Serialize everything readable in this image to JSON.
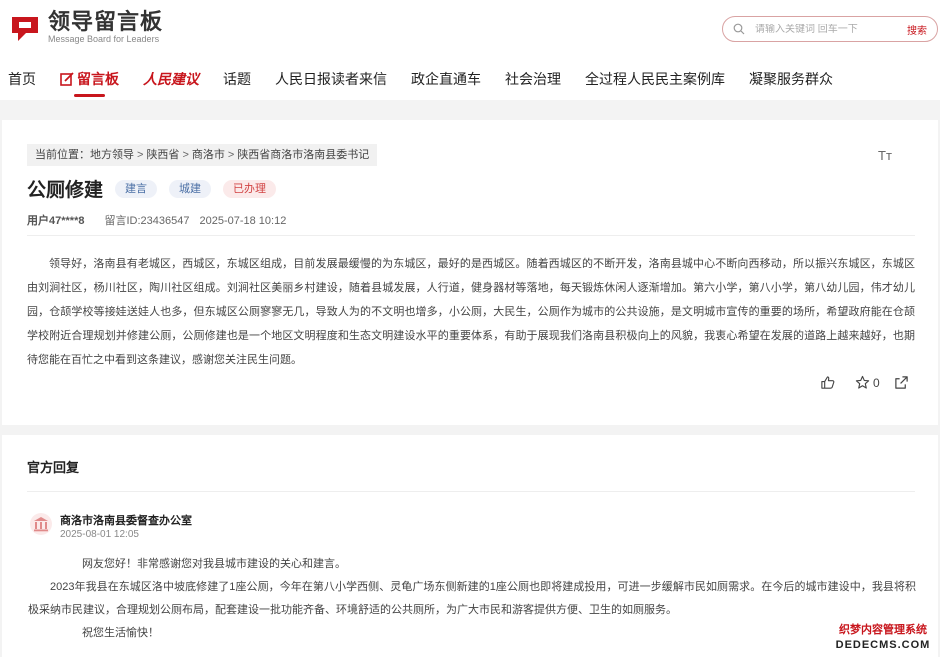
{
  "header": {
    "logo_title": "领导留言板",
    "logo_sub": "Message Board for Leaders",
    "search_placeholder": "请输入关键词 回车一下",
    "search_button": "搜索"
  },
  "nav": {
    "items": [
      "首页",
      "留言板",
      "人民建议",
      "话题",
      "人民日报读者来信",
      "政企直通车",
      "社会治理",
      "全过程人民民主案例库",
      "凝聚服务群众"
    ]
  },
  "breadcrumb": {
    "prefix": "当前位置：",
    "items": [
      "地方领导",
      "陕西省",
      "商洛市",
      "陕西省商洛市洛南县委书记"
    ]
  },
  "message": {
    "font_toggle": "Tт",
    "title": "公厕修建",
    "tags": [
      "建言",
      "城建",
      "已办理"
    ],
    "user": "用户47****8",
    "id_text": "留言ID:23436547",
    "time": "2025-07-18 10:12",
    "content": "领导好，洛南县有老城区，西城区，东城区组成，目前发展最缓慢的为东城区，最好的是西城区。随着西城区的不断开发，洛南县城中心不断向西移动，所以振兴东城区，东城区由刘涧社区，杨川社区，陶川社区组成。刘涧社区美丽乡村建设，随着县城发展，人行道，健身器材等落地，每天锻炼休闲人逐渐增加。第六小学，第八小学，第八幼儿园，伟才幼儿园，仓颉学校等接娃送娃人也多，但东城区公厕寥寥无几，导致人为的不文明也增多，小公厕，大民生，公厕作为城市的公共设施，是文明城市宣传的重要的场所，希望政府能在仓颉学校附近合理规划并修建公厕，公厕修建也是一个地区文明程度和生态文明建设水平的重要体系，有助于展现我们洛南县积极向上的风貌，我衷心希望在发展的道路上越来越好，也期待您能在百忙之中看到这条建议，感谢您关注民生问题。",
    "star_count": "0"
  },
  "reply": {
    "heading": "官方回复",
    "org": "商洛市洛南县委督查办公室",
    "time": "2025-08-01 12:05",
    "p1": "网友您好！非常感谢您对我县城市建设的关心和建言。",
    "p2": "2023年我县在东城区洛中坡底修建了1座公厕，今年在第八小学西侧、灵龟广场东侧新建的1座公厕也即将建成投用，可进一步缓解市民如厕需求。在今后的城市建设中，我县将积极采纳市民建议，合理规划公厕布局，配套建设一批功能齐备、环境舒适的公共厕所，为广大市民和游客提供方便、卫生的如厕服务。",
    "p3": "祝您生活愉快！"
  },
  "watermark": {
    "line1": "织梦内容管理系统",
    "line2": "DEDECMS.COM"
  },
  "colors": {
    "brand_red": "#c8161d",
    "tag_blue": "#4a6fa5",
    "tag_red": "#d24444"
  }
}
